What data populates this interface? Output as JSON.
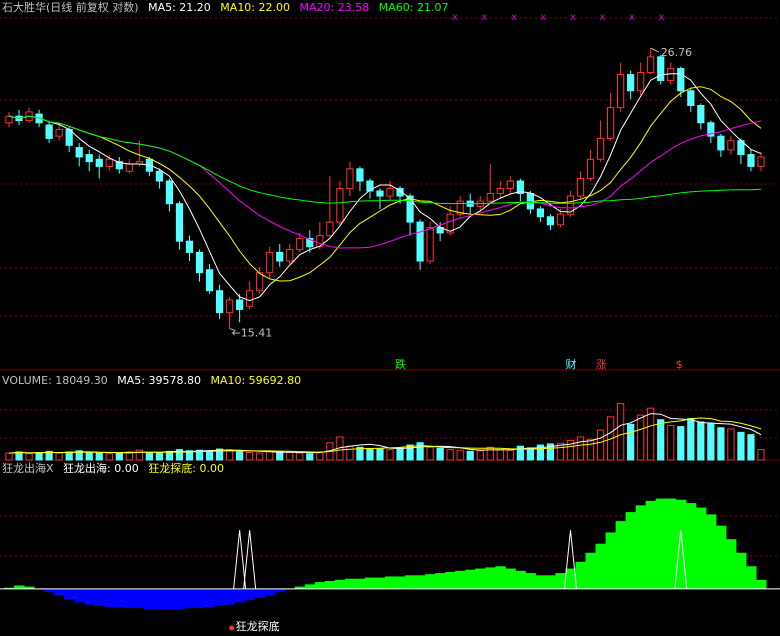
{
  "colors": {
    "bg": "#000000",
    "up": "#ff3232",
    "down": "#54ffff",
    "ma5": "#ffffff",
    "ma10": "#ffff00",
    "ma20": "#ff00ff",
    "ma60": "#00ff00",
    "grid": "#8b0000",
    "dim": "#c0c0c0",
    "positive_fill": "#00ff00",
    "negative_fill": "#0000ff"
  },
  "main_header": {
    "title": "石大胜华(日线 前复权 对数)",
    "ma5": "MA5: 21.20",
    "ma10": "MA10: 22.00",
    "ma20": "MA20: 23.58",
    "ma60": "MA60: 21.07"
  },
  "volume_header": {
    "label": "VOLUME: 18049.30",
    "ma5": "MA5: 39578.80",
    "ma10": "MA10: 59692.80"
  },
  "indicator_header": {
    "name": "狂龙出海X",
    "v1": "狂龙出海: 0.00",
    "v2": "狂龙探底: 0.00"
  },
  "toolbar_marks": [
    "x",
    "x",
    "x",
    "x",
    "x",
    "x",
    "x",
    "x"
  ],
  "chart_data": [
    {
      "type": "candlestick",
      "scale": "log",
      "ylim": [
        14.6,
        28.5
      ],
      "annotations": {
        "high_label": "26.76",
        "low_label": "15.41",
        "marks": [
          {
            "text": "跌",
            "index": 39,
            "color": "#00ff00"
          },
          {
            "text": "财",
            "index": 56,
            "color": "#54ffff"
          },
          {
            "text": "涨",
            "index": 59,
            "color": "#ff3232"
          },
          {
            "text": "$",
            "index": 67,
            "color": "#ff3232"
          }
        ]
      },
      "candles": [
        [
          23.1,
          23.4,
          23.6,
          22.9
        ],
        [
          23.4,
          23.2,
          23.7,
          23.0
        ],
        [
          23.2,
          23.6,
          23.8,
          23.1
        ],
        [
          23.5,
          23.1,
          23.7,
          22.9
        ],
        [
          23.0,
          22.4,
          23.2,
          22.2
        ],
        [
          22.5,
          22.8,
          23.1,
          22.3
        ],
        [
          22.8,
          22.1,
          22.9,
          21.8
        ],
        [
          22.0,
          21.6,
          22.2,
          21.2
        ],
        [
          21.7,
          21.4,
          21.9,
          21.0
        ],
        [
          21.5,
          21.2,
          21.7,
          20.7
        ],
        [
          21.2,
          21.5,
          21.7,
          21.0
        ],
        [
          21.4,
          21.1,
          21.6,
          20.9
        ],
        [
          21.0,
          21.3,
          21.5,
          20.9
        ],
        [
          21.3,
          21.4,
          22.3,
          21.2
        ],
        [
          21.5,
          21.0,
          21.6,
          20.8
        ],
        [
          21.0,
          20.6,
          21.1,
          20.3
        ],
        [
          20.6,
          19.7,
          20.7,
          19.4
        ],
        [
          19.7,
          18.3,
          19.8,
          18.0
        ],
        [
          18.3,
          17.9,
          18.5,
          17.6
        ],
        [
          17.9,
          17.2,
          18.0,
          16.9
        ],
        [
          17.3,
          16.6,
          17.5,
          16.5
        ],
        [
          16.6,
          15.9,
          16.8,
          15.7
        ],
        [
          15.9,
          16.3,
          16.4,
          15.41
        ],
        [
          16.3,
          16.0,
          16.5,
          15.6
        ],
        [
          16.1,
          16.6,
          16.9,
          16.0
        ],
        [
          16.6,
          17.2,
          17.4,
          16.5
        ],
        [
          17.2,
          17.9,
          18.1,
          17.0
        ],
        [
          17.9,
          17.6,
          18.2,
          17.4
        ],
        [
          17.6,
          18.0,
          18.2,
          17.5
        ],
        [
          18.0,
          18.4,
          18.6,
          17.9
        ],
        [
          18.4,
          18.1,
          18.7,
          17.9
        ],
        [
          18.1,
          18.5,
          19.0,
          18.0
        ],
        [
          18.5,
          19.0,
          20.8,
          18.4
        ],
        [
          19.0,
          20.3,
          20.6,
          18.9
        ],
        [
          20.3,
          21.1,
          21.4,
          20.0
        ],
        [
          21.1,
          20.6,
          21.2,
          20.2
        ],
        [
          20.6,
          20.2,
          20.7,
          19.9
        ],
        [
          20.2,
          20.0,
          20.3,
          19.5
        ],
        [
          20.0,
          20.3,
          20.6,
          19.8
        ],
        [
          20.3,
          20.0,
          20.4,
          19.7
        ],
        [
          20.0,
          19.0,
          20.1,
          18.5
        ],
        [
          19.0,
          17.6,
          19.1,
          17.3
        ],
        [
          17.6,
          18.8,
          19.0,
          17.5
        ],
        [
          18.8,
          18.6,
          19.0,
          18.3
        ],
        [
          18.6,
          19.3,
          19.6,
          18.5
        ],
        [
          19.3,
          19.8,
          20.0,
          19.2
        ],
        [
          19.8,
          19.6,
          20.1,
          19.3
        ],
        [
          19.6,
          19.8,
          20.0,
          19.4
        ],
        [
          19.8,
          20.1,
          21.3,
          19.7
        ],
        [
          20.1,
          20.3,
          20.6,
          19.9
        ],
        [
          20.3,
          20.6,
          20.8,
          20.1
        ],
        [
          20.6,
          20.1,
          20.7,
          19.8
        ],
        [
          20.1,
          19.5,
          20.2,
          19.3
        ],
        [
          19.5,
          19.2,
          19.6,
          19.0
        ],
        [
          19.2,
          18.9,
          19.3,
          18.7
        ],
        [
          18.9,
          19.3,
          19.5,
          18.8
        ],
        [
          19.3,
          20.0,
          20.2,
          19.2
        ],
        [
          20.0,
          20.7,
          21.0,
          19.9
        ],
        [
          20.7,
          21.5,
          21.9,
          20.6
        ],
        [
          21.5,
          22.4,
          23.2,
          21.4
        ],
        [
          22.4,
          23.8,
          24.5,
          22.3
        ],
        [
          23.8,
          25.4,
          26.0,
          23.6
        ],
        [
          25.4,
          24.6,
          25.6,
          24.2
        ],
        [
          24.6,
          25.5,
          26.0,
          24.4
        ],
        [
          25.5,
          26.3,
          26.76,
          25.4
        ],
        [
          26.3,
          25.1,
          26.4,
          24.9
        ],
        [
          25.1,
          25.7,
          26.0,
          24.9
        ],
        [
          25.7,
          24.6,
          25.8,
          24.3
        ],
        [
          24.6,
          23.9,
          24.7,
          23.6
        ],
        [
          23.9,
          23.1,
          24.0,
          22.8
        ],
        [
          23.1,
          22.5,
          23.2,
          22.2
        ],
        [
          22.5,
          21.9,
          22.6,
          21.6
        ],
        [
          21.9,
          22.3,
          22.5,
          21.7
        ],
        [
          22.3,
          21.7,
          22.4,
          21.3
        ],
        [
          21.7,
          21.2,
          21.9,
          21.0
        ],
        [
          21.2,
          21.6,
          21.8,
          21.0
        ]
      ]
    },
    {
      "type": "bar",
      "series_name": "VOLUME",
      "ylim": [
        0,
        125000
      ],
      "values": [
        12000,
        14000,
        11000,
        13000,
        15000,
        12000,
        14000,
        16000,
        13000,
        12000,
        11000,
        12000,
        14000,
        17000,
        13000,
        12000,
        15000,
        18000,
        16000,
        17000,
        16000,
        19000,
        18000,
        14000,
        13000,
        12000,
        15000,
        14000,
        13000,
        12000,
        11000,
        14000,
        30000,
        40000,
        24000,
        22000,
        20000,
        19000,
        18000,
        21000,
        26000,
        30000,
        22000,
        20000,
        18000,
        17000,
        15000,
        16000,
        22000,
        18000,
        17000,
        24000,
        21000,
        26000,
        28000,
        29000,
        34000,
        40000,
        36000,
        52000,
        75000,
        98000,
        62000,
        78000,
        90000,
        70000,
        60000,
        58000,
        72000,
        66000,
        64000,
        56000,
        54000,
        48000,
        44000,
        18049
      ]
    },
    {
      "type": "area",
      "series_name": "狂龙出海",
      "ylim": [
        -0.4,
        1.0
      ],
      "annotations": {
        "bottom_label": "狂龙探底"
      },
      "values": [
        0.01,
        0.03,
        0.02,
        0.0,
        -0.03,
        -0.06,
        -0.09,
        -0.12,
        -0.14,
        -0.15,
        -0.16,
        -0.16,
        -0.17,
        -0.17,
        -0.18,
        -0.18,
        -0.18,
        -0.18,
        -0.17,
        -0.17,
        -0.16,
        -0.15,
        -0.14,
        -0.12,
        -0.1,
        -0.08,
        -0.06,
        -0.03,
        0.0,
        0.02,
        0.04,
        0.06,
        0.07,
        0.08,
        0.09,
        0.09,
        0.1,
        0.1,
        0.11,
        0.11,
        0.12,
        0.12,
        0.13,
        0.14,
        0.15,
        0.16,
        0.17,
        0.18,
        0.19,
        0.2,
        0.18,
        0.16,
        0.14,
        0.12,
        0.12,
        0.14,
        0.18,
        0.24,
        0.32,
        0.4,
        0.5,
        0.6,
        0.68,
        0.74,
        0.78,
        0.8,
        0.8,
        0.79,
        0.76,
        0.72,
        0.66,
        0.56,
        0.44,
        0.32,
        0.2,
        0.08
      ],
      "signal_indices": [
        23,
        24,
        56,
        67
      ]
    }
  ]
}
